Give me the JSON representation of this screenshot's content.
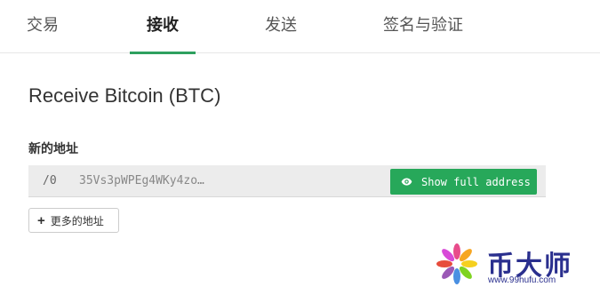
{
  "tabs": [
    {
      "label": "交易",
      "active": false
    },
    {
      "label": "接收",
      "active": true
    },
    {
      "label": "发送",
      "active": false
    },
    {
      "label": "签名与验证",
      "active": false
    }
  ],
  "colors": {
    "accent": "#2ea05f",
    "button": "#27a85a",
    "watermark": "#2a2f8e"
  },
  "receive": {
    "title": "Receive Bitcoin (BTC)",
    "new_address_label": "新的地址",
    "address": {
      "path": "/0",
      "value": "35Vs3pWPEg4WKy4zo…",
      "show_button_label": "Show full address",
      "show_button_icon": "eye-icon"
    },
    "more_button": {
      "label": "更多的地址",
      "icon": "plus-icon"
    }
  },
  "watermark": {
    "text": "币大师",
    "url": "www.99hufu.com"
  }
}
